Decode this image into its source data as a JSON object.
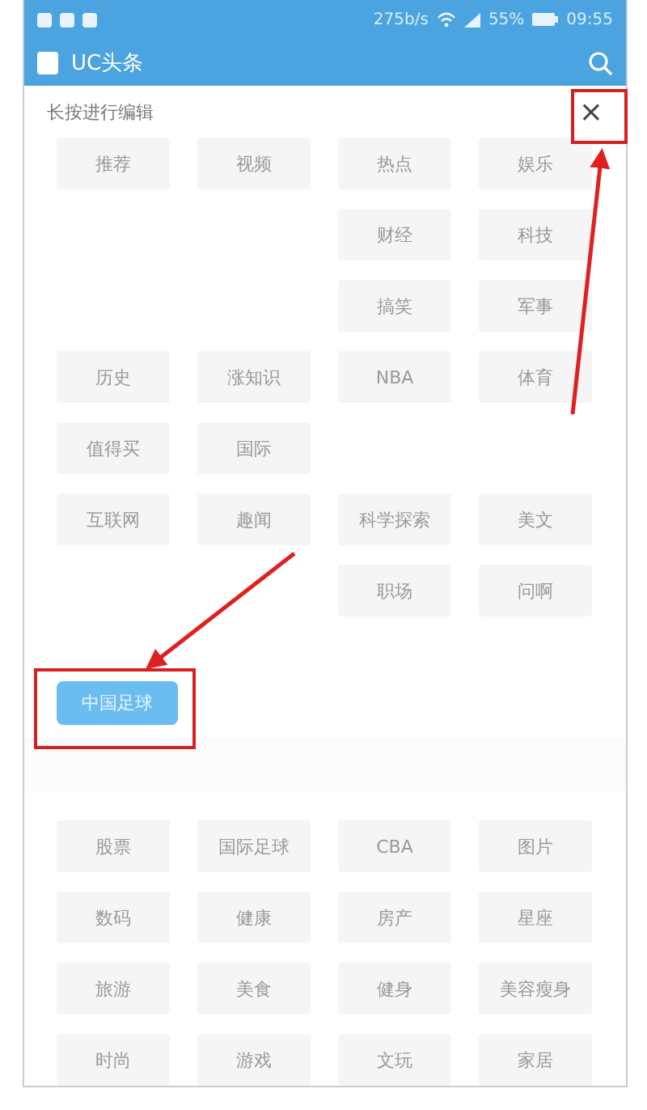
{
  "status_bar": {
    "speed": "275b/s",
    "battery": "55%",
    "time": "09:55"
  },
  "app_bar": {
    "title": "UC头条"
  },
  "editor": {
    "hint": "长按进行编辑",
    "close": "×",
    "channels": [
      {
        "kind": "tag",
        "label": "推荐"
      },
      {
        "kind": "tag",
        "label": "视频"
      },
      {
        "kind": "tag",
        "label": "热点"
      },
      {
        "kind": "tag",
        "label": "娱乐"
      },
      {
        "kind": "blank"
      },
      {
        "kind": "blank"
      },
      {
        "kind": "tag",
        "label": "财经"
      },
      {
        "kind": "tag",
        "label": "科技"
      },
      {
        "kind": "blank"
      },
      {
        "kind": "blank"
      },
      {
        "kind": "tag",
        "label": "搞笑"
      },
      {
        "kind": "tag",
        "label": "军事"
      },
      {
        "kind": "tag",
        "label": "历史"
      },
      {
        "kind": "tag",
        "label": "涨知识"
      },
      {
        "kind": "tag",
        "label": "NBA"
      },
      {
        "kind": "tag",
        "label": "体育"
      },
      {
        "kind": "tag",
        "label": "值得买"
      },
      {
        "kind": "tag",
        "label": "国际"
      },
      {
        "kind": "blank"
      },
      {
        "kind": "blank"
      },
      {
        "kind": "tag",
        "label": "互联网"
      },
      {
        "kind": "tag",
        "label": "趣闻"
      },
      {
        "kind": "tag",
        "label": "科学探索"
      },
      {
        "kind": "tag",
        "label": "美文"
      },
      {
        "kind": "blank"
      },
      {
        "kind": "blank"
      },
      {
        "kind": "tag",
        "label": "职场"
      },
      {
        "kind": "tag",
        "label": "问啊"
      }
    ],
    "dragging": {
      "label": "中国足球"
    },
    "more_channels": [
      {
        "label": "股票"
      },
      {
        "label": "国际足球"
      },
      {
        "label": "CBA"
      },
      {
        "label": "图片"
      },
      {
        "label": "数码"
      },
      {
        "label": "健康"
      },
      {
        "label": "房产"
      },
      {
        "label": "星座"
      },
      {
        "label": "旅游"
      },
      {
        "label": "美食"
      },
      {
        "label": "健身"
      },
      {
        "label": "美容瘦身"
      },
      {
        "label": "时尚"
      },
      {
        "label": "游戏"
      },
      {
        "label": "文玩"
      },
      {
        "label": "家居"
      }
    ]
  }
}
